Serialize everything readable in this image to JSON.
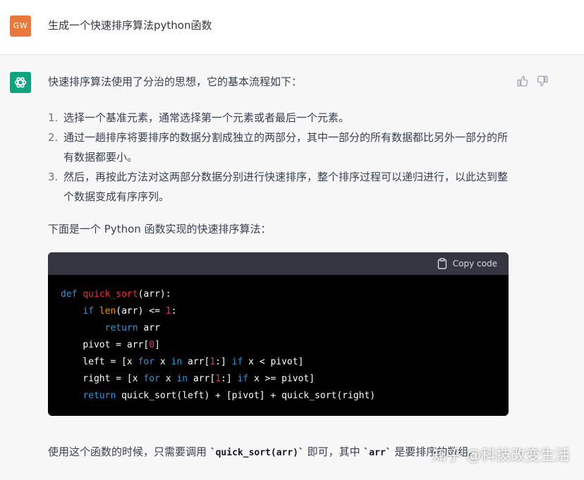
{
  "user_message": {
    "avatar_initials": "GW",
    "text": "生成一个快速排序算法python函数"
  },
  "assistant": {
    "intro": "快速排序算法使用了分治的思想，它的基本流程如下：",
    "steps": [
      {
        "num": "1.",
        "text": "选择一个基准元素，通常选择第一个元素或者最后一个元素。"
      },
      {
        "num": "2.",
        "text": "通过一趟排序将要排序的数据分割成独立的两部分，其中一部分的所有数据都比另外一部分的所有数据都要小。"
      },
      {
        "num": "3.",
        "text": "然后，再按此方法对这两部分数据分别进行快速排序，整个排序过程可以递归进行，以此达到整个数据变成有序序列。"
      }
    ],
    "code_intro": "下面是一个 Python 函数实现的快速排序算法：",
    "code_block": {
      "copy_label": "Copy code",
      "lines": [
        {
          "kw": "def",
          "fn": "quick_sort",
          "rest": "(arr):"
        },
        {
          "indent": "    ",
          "kw": "if",
          "bi": "len",
          "mid": "(arr) <= ",
          "num": "1",
          "tail": ":"
        },
        {
          "indent": "        ",
          "kw": "return",
          "rest": " arr"
        },
        {
          "indent": "    ",
          "pre": "pivot = arr[",
          "num": "0",
          "tail": "]"
        },
        {
          "indent": "    ",
          "text": "left = [x for x in arr[1:] if x < pivot]"
        },
        {
          "indent": "    ",
          "text": "right = [x for x in arr[1:] if x >= pivot]"
        },
        {
          "indent": "    ",
          "kw": "return",
          "rest": " quick_sort(left) + [pivot] + quick_sort(right)"
        }
      ]
    },
    "footer": {
      "before": "使用这个函数的时候，只需要调用 ",
      "code1": "`quick_sort(arr)`",
      "middle": " 即可，其中 ",
      "code2": "`arr`",
      "after": " 是要排序的数组。"
    }
  },
  "watermark": "知乎 @科技改变生活"
}
